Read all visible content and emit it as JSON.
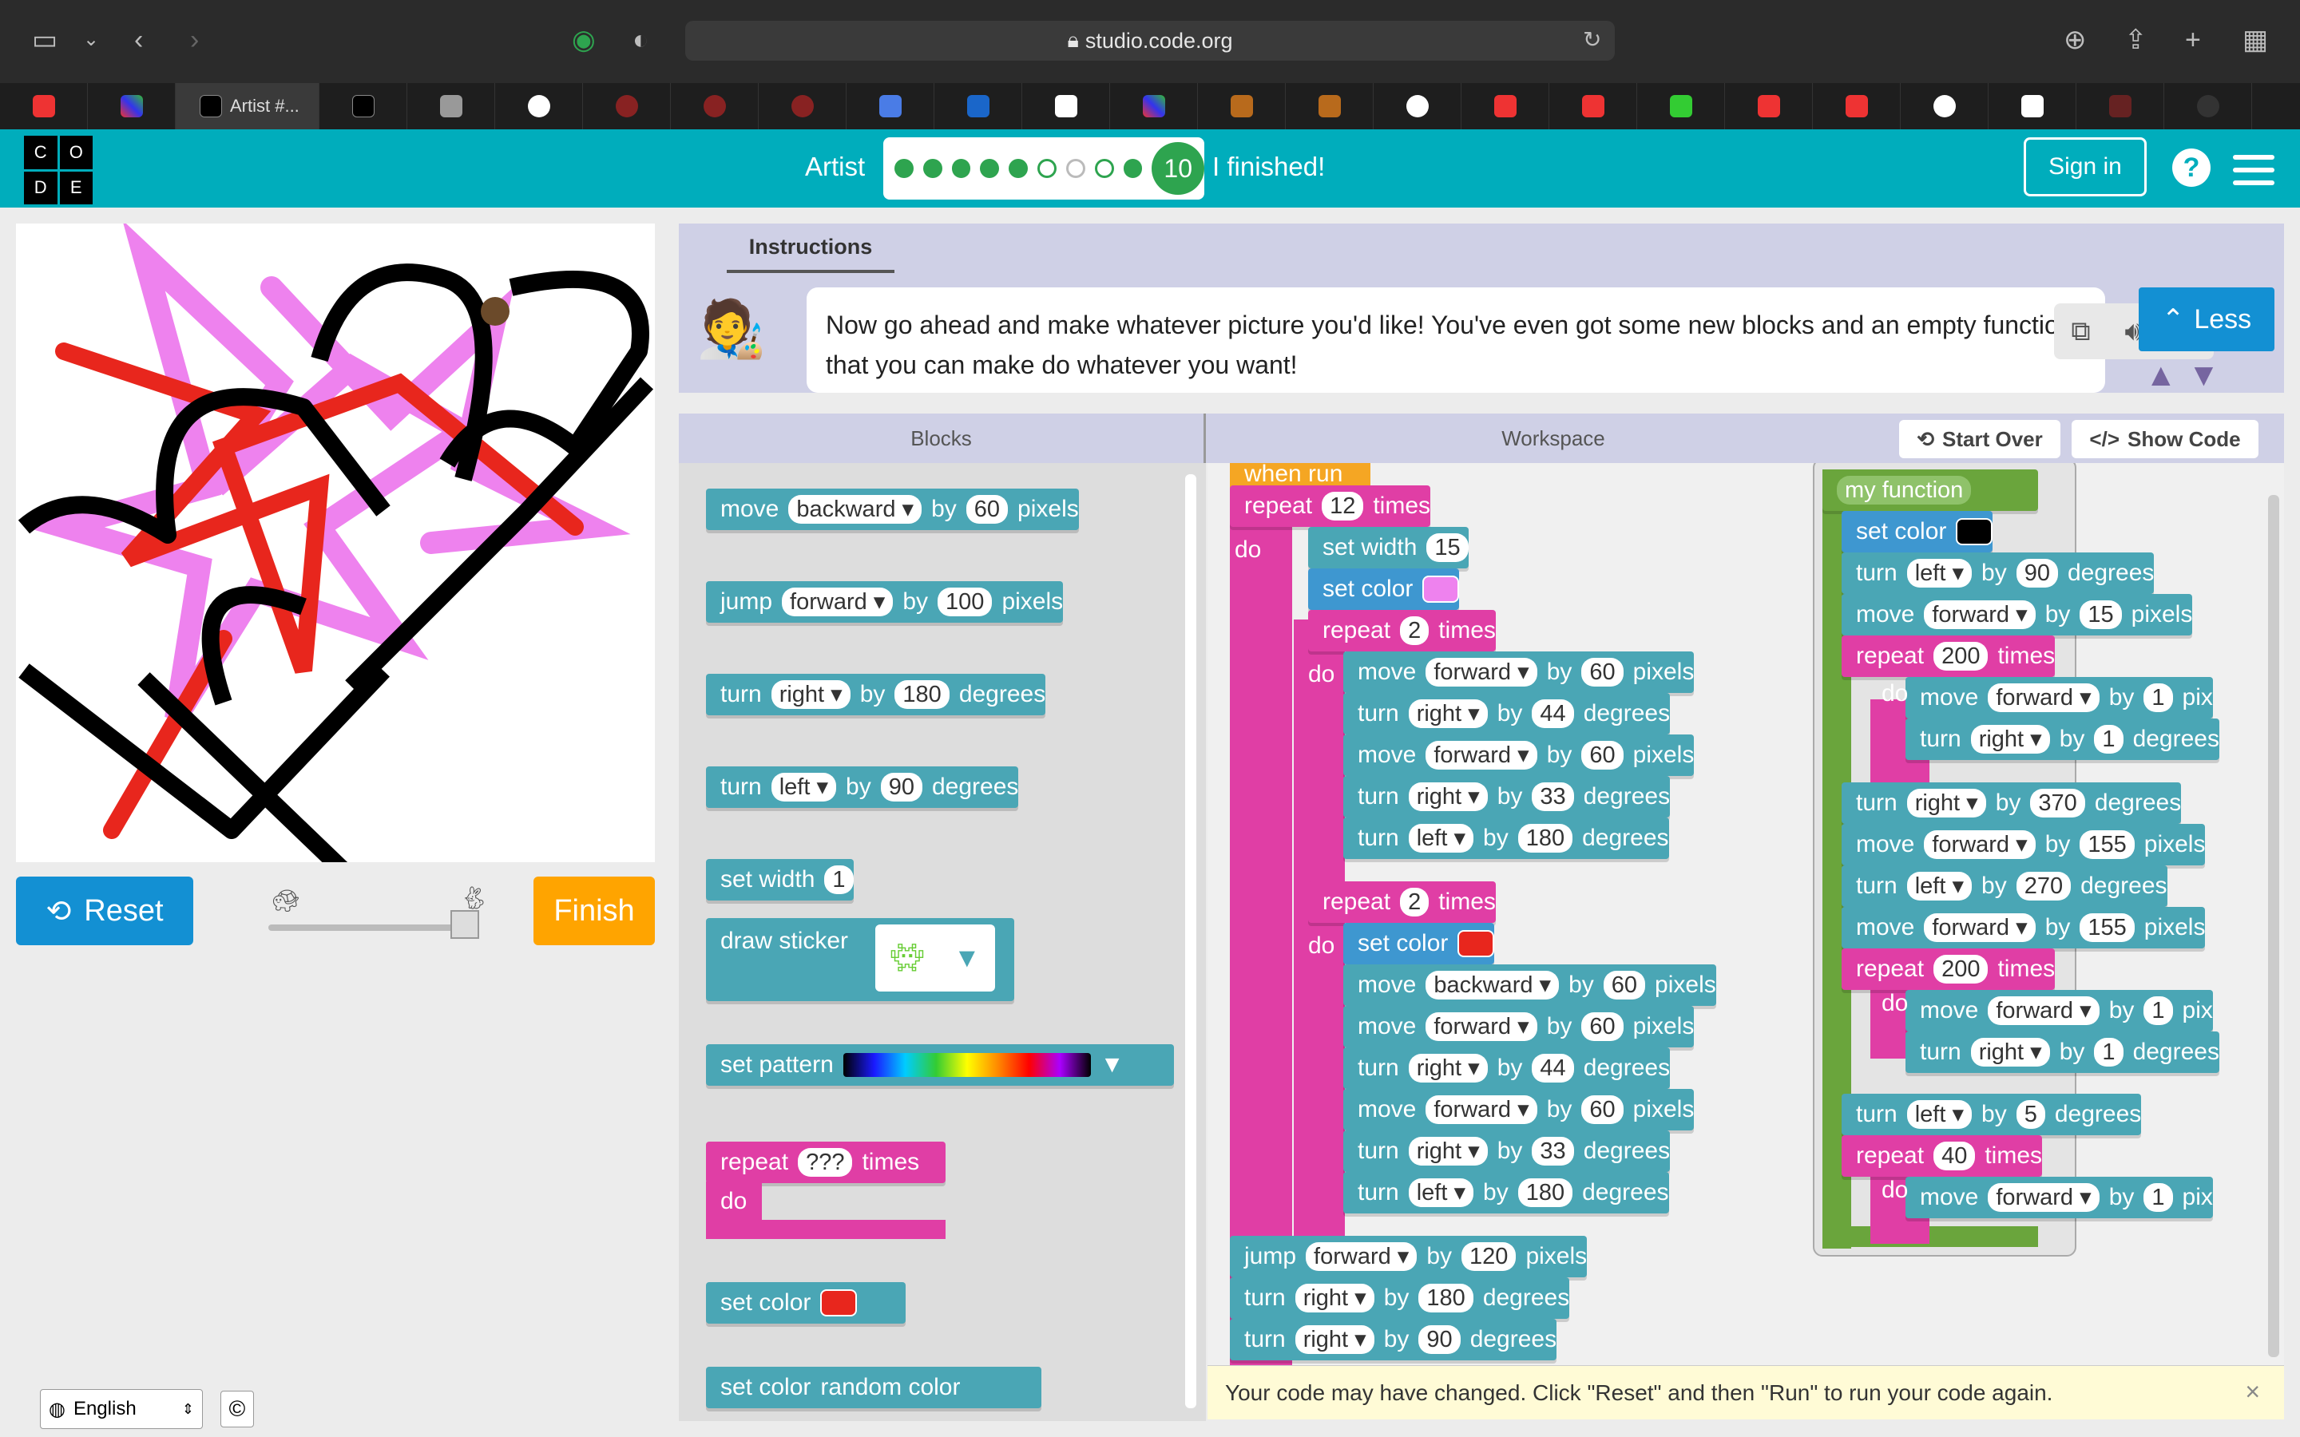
{
  "browser": {
    "url": "studio.code.org",
    "active_tab": "Artist #..."
  },
  "header": {
    "logo_letters": [
      "C",
      "O",
      "D",
      "E"
    ],
    "level_name": "Artist",
    "current_level": "10",
    "finished_text": "I finished!",
    "sign_in": "Sign in",
    "help": "?"
  },
  "progress": {
    "completed": 5,
    "partial": 1,
    "empty": 1,
    "then_completed": 2,
    "current": 10
  },
  "controls": {
    "reset": "Reset",
    "finish": "Finish"
  },
  "footer": {
    "language": "English",
    "copyright": "©"
  },
  "instructions": {
    "tab": "Instructions",
    "text": "Now go ahead and make whatever picture you'd like! You've even got some new blocks and an empty function that you can make do whatever you want!",
    "less": "Less"
  },
  "panels": {
    "blocks": "Blocks",
    "workspace": "Workspace",
    "start_over": "Start Over",
    "show_code": "Show Code"
  },
  "toolbox": [
    {
      "kind": "teal",
      "parts": [
        "move",
        "backward ▾",
        "by",
        "60",
        "pixels"
      ]
    },
    {
      "kind": "teal",
      "parts": [
        "jump",
        "forward ▾",
        "by",
        "100",
        "pixels"
      ]
    },
    {
      "kind": "teal",
      "parts": [
        "turn",
        "right ▾",
        "by",
        "180",
        "degrees"
      ]
    },
    {
      "kind": "teal",
      "parts": [
        "turn",
        "left ▾",
        "by",
        "90",
        "degrees"
      ]
    },
    {
      "kind": "teal",
      "parts": [
        "set width",
        "1"
      ]
    }
  ],
  "toolbox_extra": {
    "draw_sticker": "draw sticker",
    "set_pattern": "set pattern",
    "repeat": "repeat",
    "repeat_q": "???",
    "times": "times",
    "do": "do",
    "set_color": "set color",
    "random_color": "random color"
  },
  "program": {
    "when_run": "when run",
    "lines": [
      [
        "repeat",
        "12",
        "times"
      ],
      [
        "set width",
        "15"
      ],
      [
        "set color"
      ],
      [
        "repeat",
        "2",
        "times"
      ],
      [
        "move",
        "forward ▾",
        "by",
        "60",
        "pixels"
      ],
      [
        "turn",
        "right ▾",
        "by",
        "44",
        "degrees"
      ],
      [
        "move",
        "forward ▾",
        "by",
        "60",
        "pixels"
      ],
      [
        "turn",
        "right ▾",
        "by",
        "33",
        "degrees"
      ],
      [
        "turn",
        "left ▾",
        "by",
        "180",
        "degrees"
      ],
      [
        "repeat",
        "2",
        "times"
      ],
      [
        "set color"
      ],
      [
        "move",
        "backward ▾",
        "by",
        "60",
        "pixels"
      ],
      [
        "move",
        "forward ▾",
        "by",
        "60",
        "pixels"
      ],
      [
        "turn",
        "right ▾",
        "by",
        "44",
        "degrees"
      ],
      [
        "move",
        "forward ▾",
        "by",
        "60",
        "pixels"
      ],
      [
        "turn",
        "right ▾",
        "by",
        "33",
        "degrees"
      ],
      [
        "turn",
        "left ▾",
        "by",
        "180",
        "degrees"
      ],
      [
        "jump",
        "forward ▾",
        "by",
        "120",
        "pixels"
      ],
      [
        "turn",
        "right ▾",
        "by",
        "180",
        "degrees"
      ],
      [
        "turn",
        "right ▾",
        "by",
        "90",
        "degrees"
      ]
    ],
    "do": "do"
  },
  "function": {
    "name": "my function",
    "lines": [
      [
        "set color"
      ],
      [
        "turn",
        "left ▾",
        "by",
        "90",
        "degrees"
      ],
      [
        "move",
        "forward ▾",
        "by",
        "15",
        "pixels"
      ],
      [
        "repeat",
        "200",
        "times"
      ],
      [
        "move",
        "forward ▾",
        "by",
        "1",
        "pix"
      ],
      [
        "turn",
        "right ▾",
        "by",
        "1",
        "degrees"
      ],
      [
        "turn",
        "right ▾",
        "by",
        "370",
        "degrees"
      ],
      [
        "move",
        "forward ▾",
        "by",
        "155",
        "pixels"
      ],
      [
        "turn",
        "left ▾",
        "by",
        "270",
        "degrees"
      ],
      [
        "move",
        "forward ▾",
        "by",
        "155",
        "pixels"
      ],
      [
        "repeat",
        "200",
        "times"
      ],
      [
        "move",
        "forward ▾",
        "by",
        "1",
        "pix"
      ],
      [
        "turn",
        "right ▾",
        "by",
        "1",
        "degrees"
      ],
      [
        "turn",
        "left ▾",
        "by",
        "5",
        "degrees"
      ],
      [
        "repeat",
        "40",
        "times"
      ],
      [
        "move",
        "forward ▾",
        "by",
        "1",
        "pix"
      ]
    ]
  },
  "toast": {
    "text": "Your code may have changed. Click \"Reset\" and then \"Run\" to run your code again.",
    "close": "×"
  },
  "colors": {
    "teal": "#4aa6b5",
    "pink": "#e03ea5",
    "green": "#6aa53c",
    "header": "#00adbc",
    "magenta_swatch": "#ee82ee",
    "red_swatch": "#e8261d",
    "black_swatch": "#000000"
  }
}
